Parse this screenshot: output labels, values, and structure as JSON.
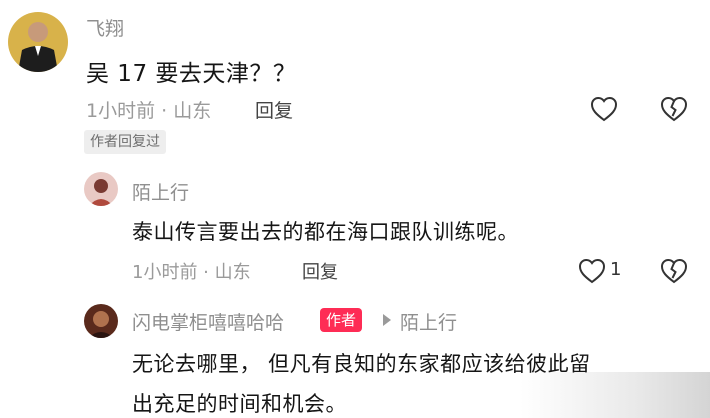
{
  "comments": [
    {
      "username": "飞翔",
      "text": "吴 17 要去天津？？",
      "meta": "1小时前 · 山东",
      "reply_label": "回复",
      "author_replied_tag": "作者回复过"
    },
    {
      "username": "陌上行",
      "text": "泰山传言要出去的都在海口跟队训练呢。",
      "meta": "1小时前 · 山东",
      "reply_label": "回复",
      "like_count": "1"
    },
    {
      "username": "闪电掌柜嘻嘻哈哈",
      "author_badge": "作者",
      "reply_to": "陌上行",
      "text_line1": "无论去哪里， 但凡有良知的东家都应该给彼此留",
      "text_line2": "出充足的时间和机会。"
    }
  ],
  "icons": {
    "like": "heart-outline-icon",
    "dislike": "broken-heart-icon",
    "reply_arrow": "triangle-right-icon"
  },
  "colors": {
    "author_badge": "#fe2c55",
    "muted_text": "#8f8f8f"
  }
}
